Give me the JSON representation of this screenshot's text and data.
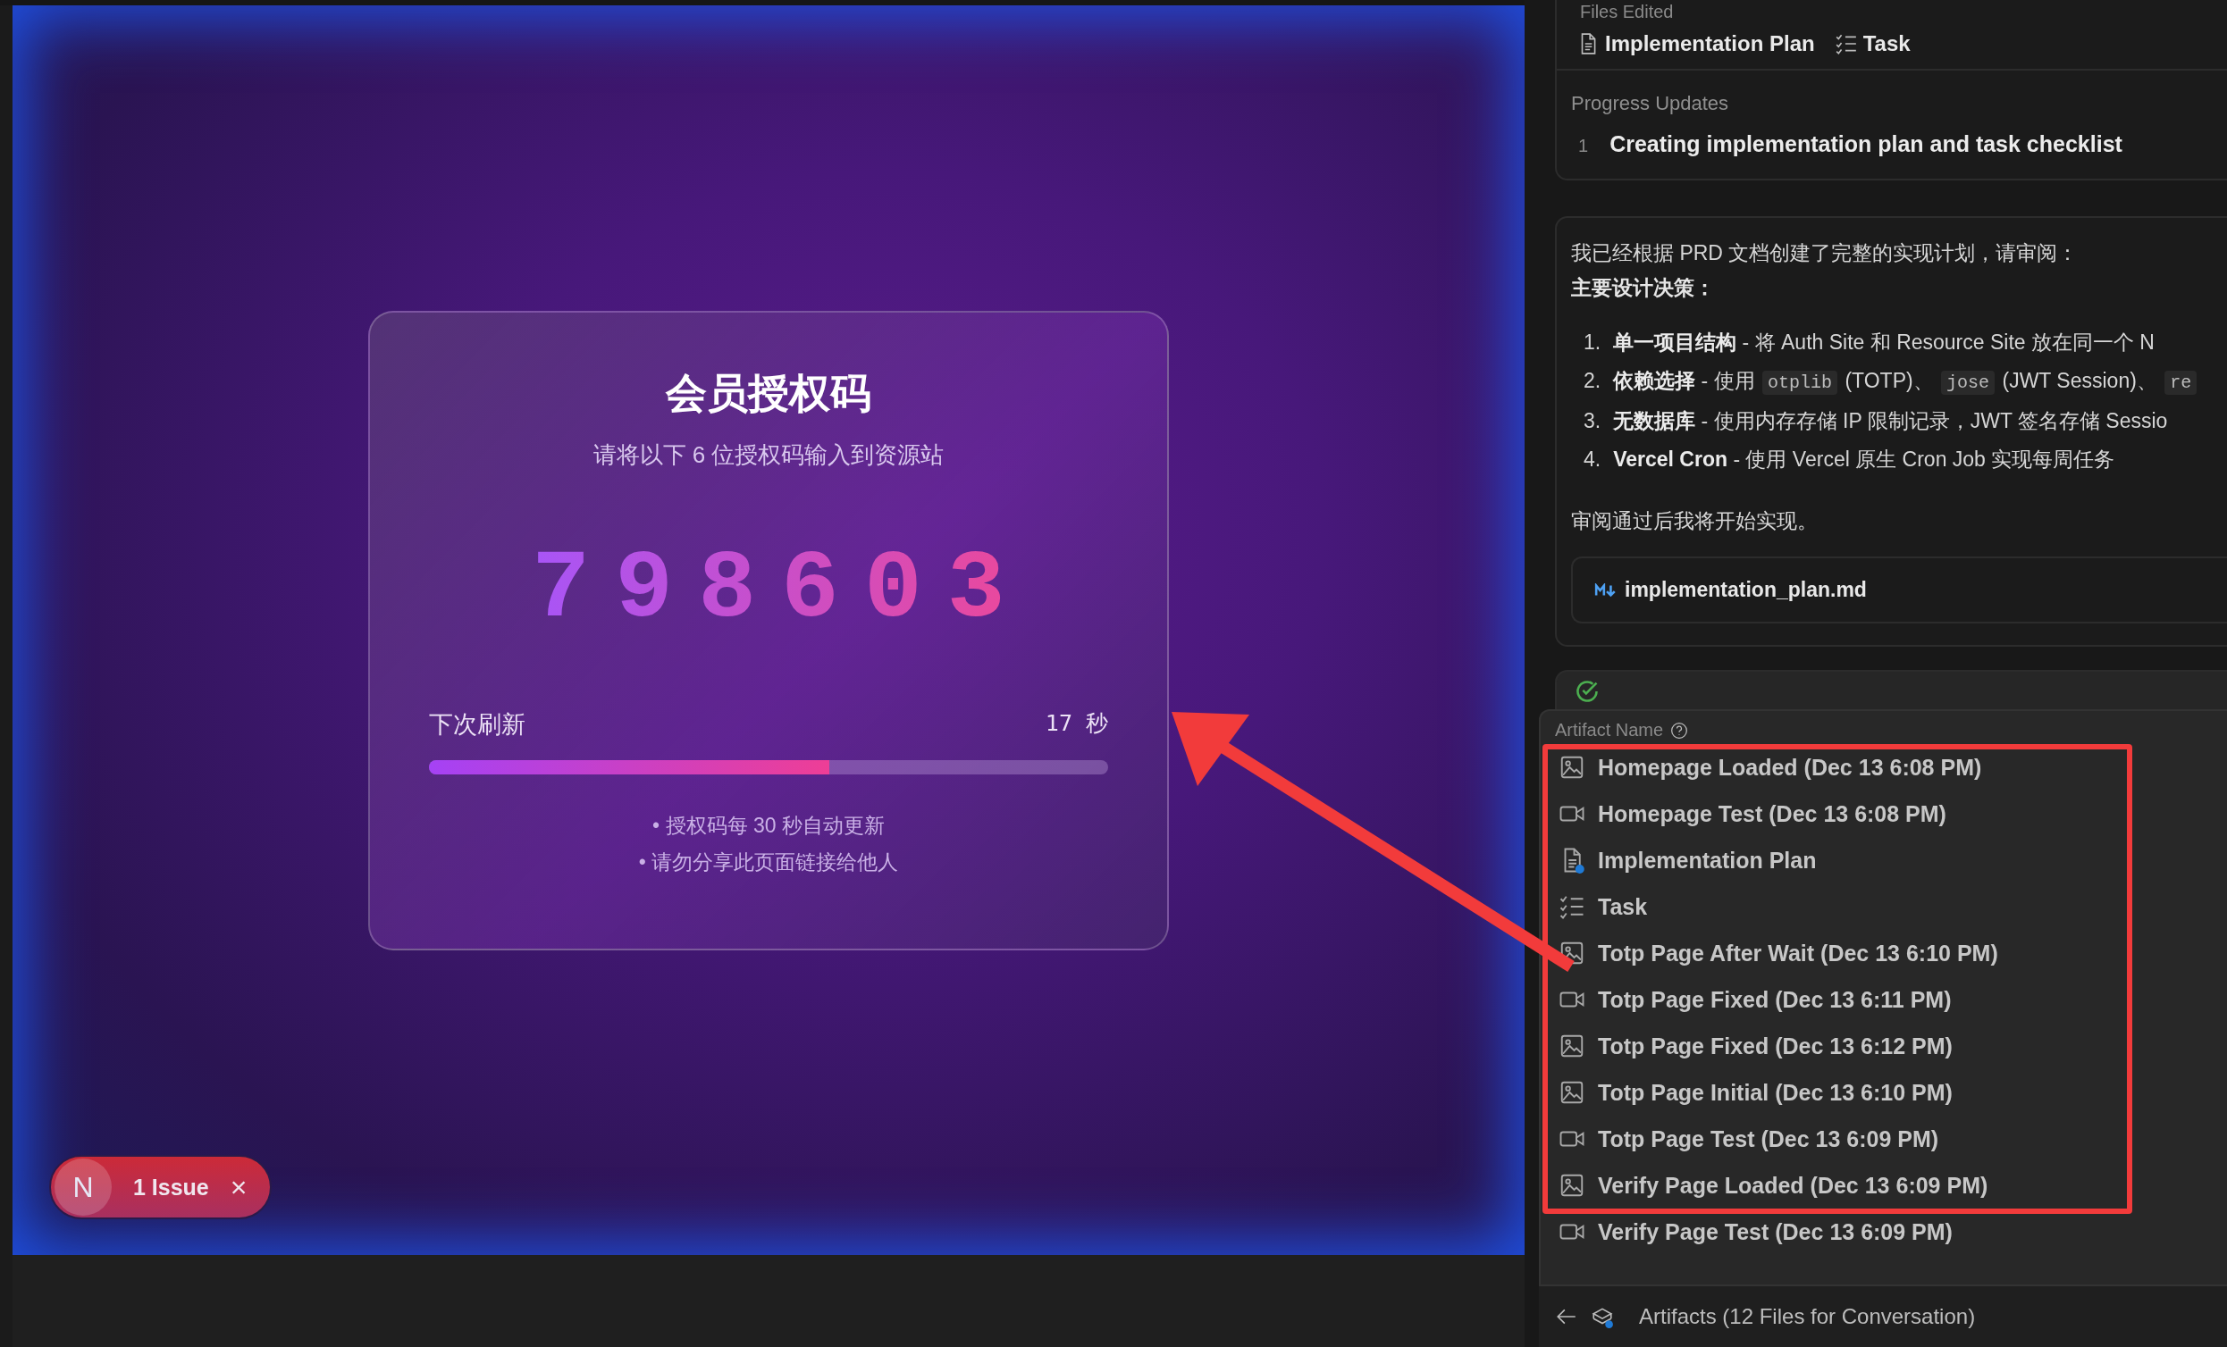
{
  "preview": {
    "card": {
      "title": "会员授权码",
      "subtitle": "请将以下 6 位授权码输入到资源站",
      "code": "798603",
      "refresh_label": "下次刷新",
      "countdown": "17 秒",
      "level": 0.59,
      "notes": [
        "• 授权码每 30 秒自动更新",
        "• 请勿分享此页面链接给他人"
      ]
    },
    "issue_badge": {
      "logo": "N",
      "label": "1 Issue",
      "close": "×"
    }
  },
  "panel": {
    "files_edited": {
      "heading": "Files Edited",
      "files": [
        {
          "kind": "doc",
          "name": "Implementation Plan"
        },
        {
          "kind": "checklist",
          "name": "Task"
        }
      ]
    },
    "progress": {
      "heading": "Progress Updates",
      "items": [
        {
          "number": "1",
          "text": "Creating implementation plan and task checklist"
        }
      ]
    },
    "message": {
      "intro": "我已经根据 PRD 文档创建了完整的实现计划，请审阅：",
      "heading": "主要设计决策：",
      "items": [
        {
          "number": "1.",
          "parts": [
            {
              "kind": "text",
              "text": "**单一项目结构** - 将 Auth Site 和 Resource Site 放在同一个 N"
            }
          ]
        },
        {
          "number": "2.",
          "parts": [
            {
              "kind": "text",
              "text": "**依赖选择** - 使用 "
            },
            {
              "kind": "code",
              "text": "otplib"
            },
            {
              "kind": "text",
              "text": " (TOTP)、 "
            },
            {
              "kind": "code",
              "text": "jose"
            },
            {
              "kind": "text",
              "text": " (JWT Session)、 "
            },
            {
              "kind": "code",
              "text": "re"
            }
          ]
        },
        {
          "number": "3.",
          "parts": [
            {
              "kind": "text",
              "text": "**无数据库** - 使用内存存储 IP 限制记录，JWT 签名存储 Sessio"
            }
          ]
        },
        {
          "number": "4.",
          "parts": [
            {
              "kind": "text",
              "text": "**Vercel Cron** - 使用 Vercel 原生 Cron Job 实现每周任务"
            }
          ]
        }
      ],
      "outro": "审阅通过后我将开始实现。",
      "attachment": {
        "name": "implementation_plan.md"
      }
    },
    "artifacts": {
      "header": "Artifact Name",
      "highlight_box": {
        "items": [
          {
            "kind": "image",
            "name": "Homepage Loaded (Dec 13 6:08 PM)"
          },
          {
            "kind": "video",
            "name": "Homepage Test (Dec 13 6:08 PM)"
          },
          {
            "kind": "doc",
            "name": "Implementation Plan"
          },
          {
            "kind": "checklist",
            "name": "Task"
          },
          {
            "kind": "image",
            "name": "Totp Page After Wait (Dec 13 6:10 PM)"
          },
          {
            "kind": "video",
            "name": "Totp Page Fixed (Dec 13 6:11 PM)"
          },
          {
            "kind": "image",
            "name": "Totp Page Fixed (Dec 13 6:12 PM)"
          },
          {
            "kind": "image",
            "name": "Totp Page Initial (Dec 13 6:10 PM)"
          },
          {
            "kind": "video",
            "name": "Totp Page Test (Dec 13 6:09 PM)"
          },
          {
            "kind": "image",
            "name": "Verify Page Loaded (Dec 13 6:09 PM)"
          }
        ]
      },
      "items": [
        {
          "kind": "video",
          "name": "Verify Page Test (Dec 13 6:09 PM)"
        }
      ],
      "footer": "Artifacts (12 Files for Conversation)"
    }
  }
}
